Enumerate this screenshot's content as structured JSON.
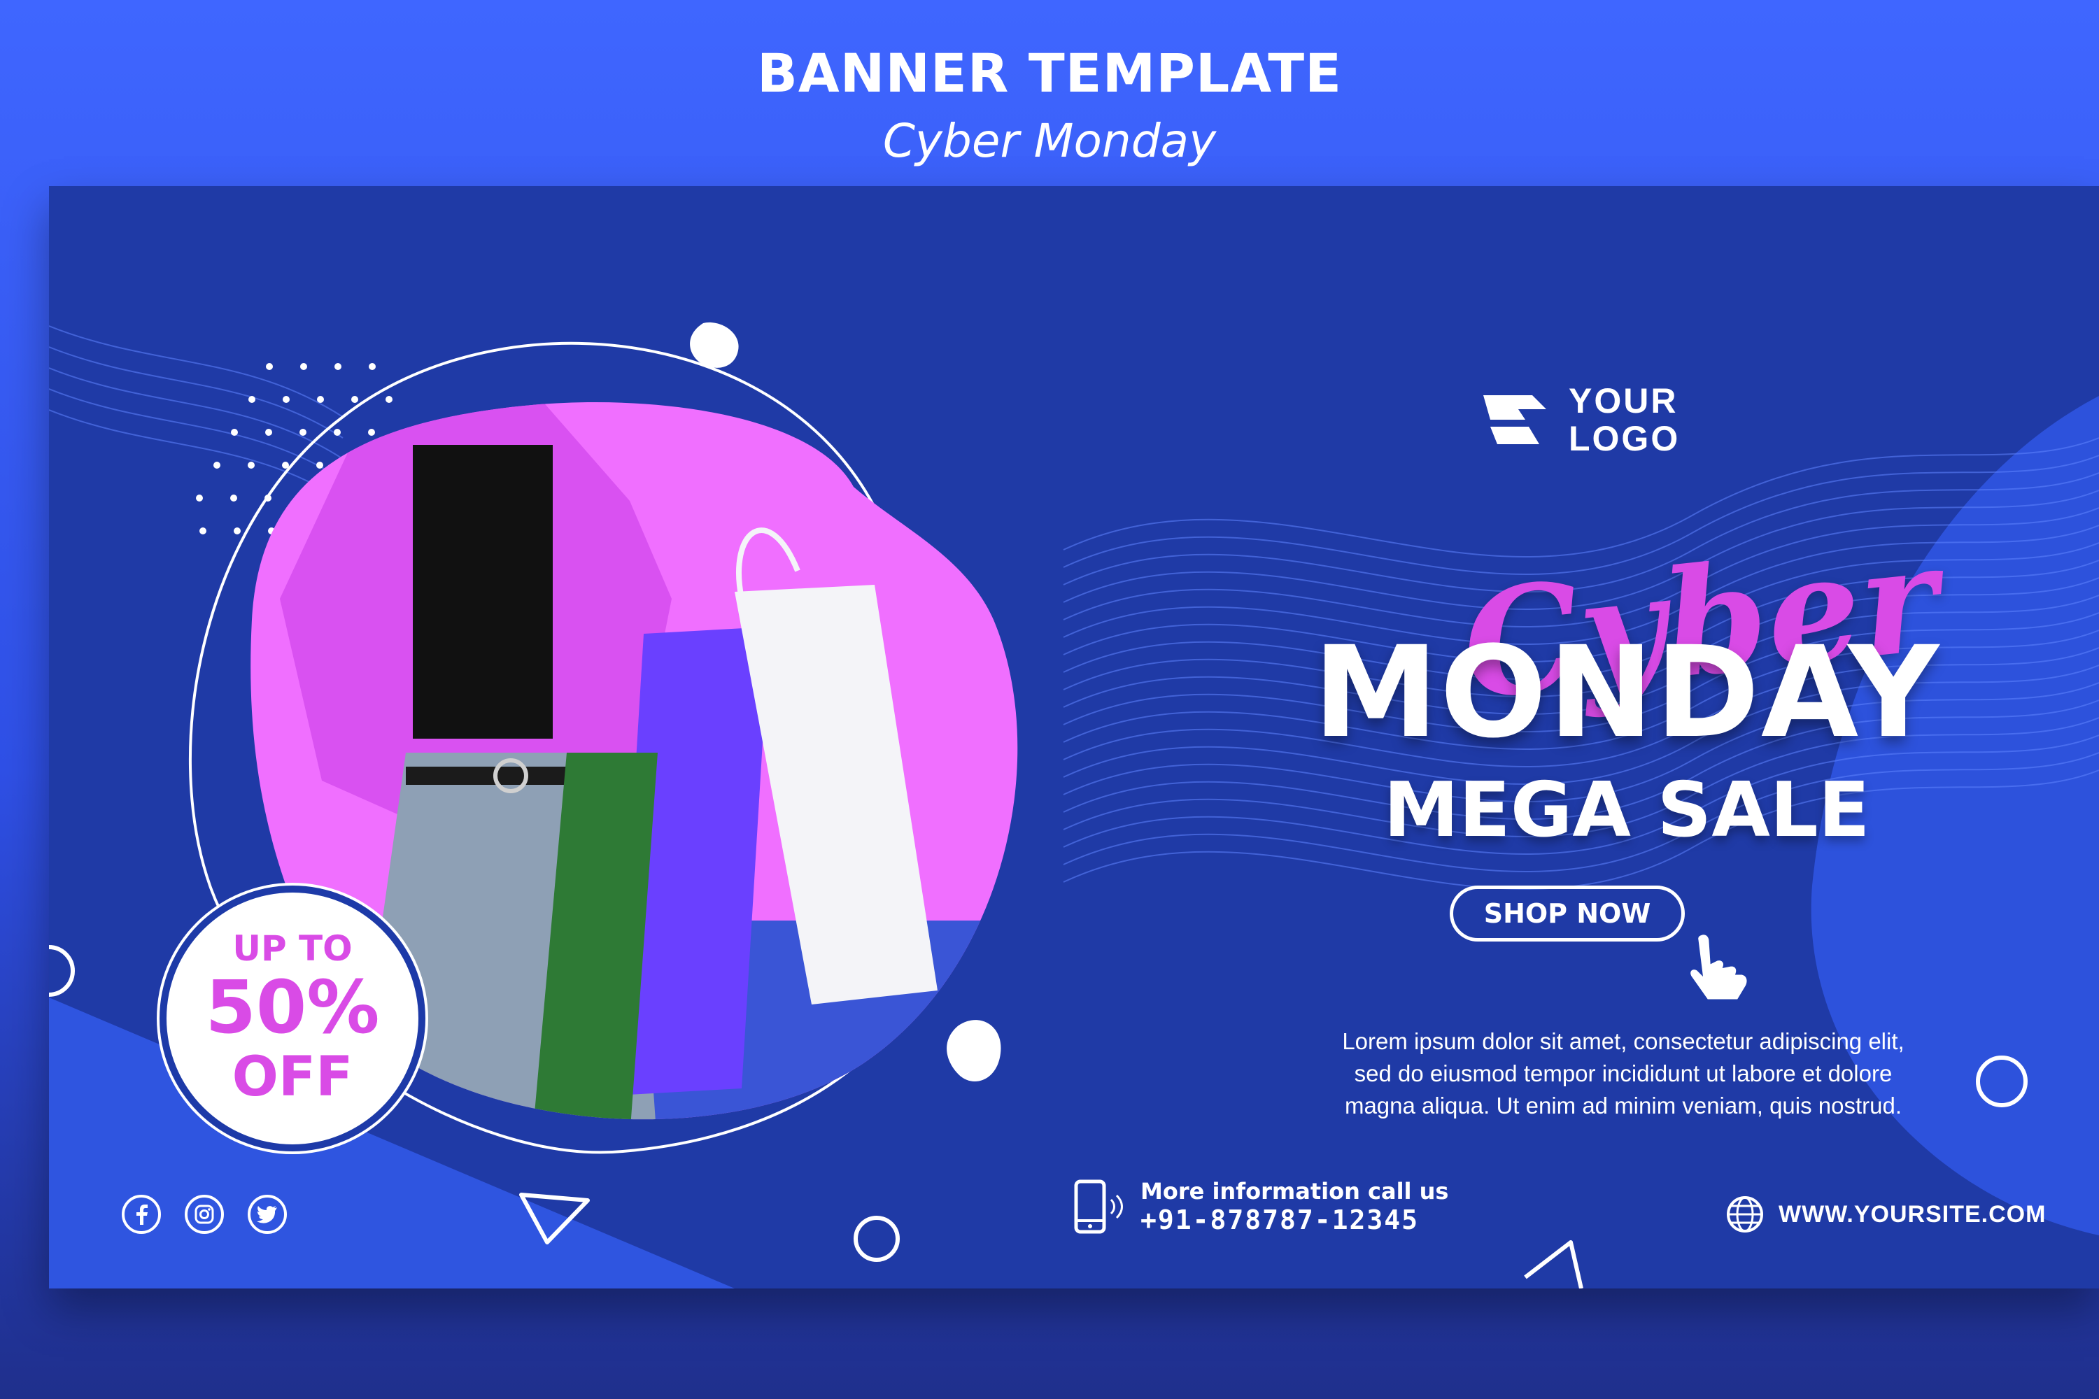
{
  "header": {
    "title": "BANNER TEMPLATE",
    "subtitle": "Cyber Monday"
  },
  "banner": {
    "logo": {
      "line1": "YOUR",
      "line2": "LOGO"
    },
    "headline_script": "Cyber",
    "headline_main": "MONDAY",
    "headline_sub": "MEGA SALE",
    "cta": "SHOP NOW",
    "description": [
      "Lorem ipsum dolor sit amet, consectetur adipiscing elit,",
      "sed do eiusmod tempor incididunt ut labore et dolore",
      "magna aliqua. Ut enim ad minim veniam, quis nostrud."
    ],
    "badge": {
      "line1": "UP TO",
      "line2": "50%",
      "line3": "OFF"
    },
    "contact": {
      "label": "More information call us",
      "phone": "+91-878787-12345"
    },
    "website": "WWW.YOURSITE.COM",
    "social_icons": [
      "facebook-icon",
      "instagram-icon",
      "twitter-icon"
    ]
  },
  "colors": {
    "background": "#3f66ff",
    "banner": "#1d3aa8",
    "accent": "#d94be6",
    "photo_backdrop": "#f06fff",
    "text": "#ffffff"
  }
}
